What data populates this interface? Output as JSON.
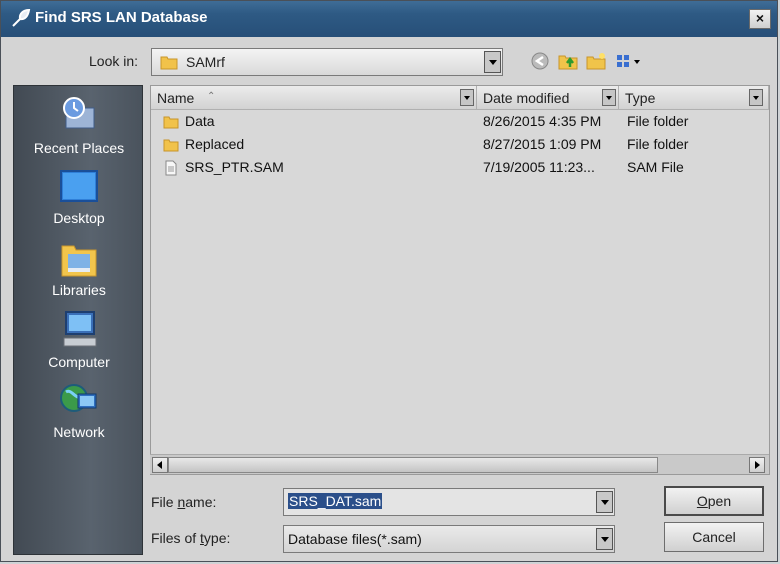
{
  "window": {
    "title": "Find SRS LAN Database",
    "close_glyph": "×"
  },
  "look_in": {
    "label": "Look in:",
    "value": "SAMrf"
  },
  "toolbar": {
    "icons": [
      "back-icon",
      "up-folder-icon",
      "new-folder-icon",
      "views-menu-icon"
    ]
  },
  "places": [
    {
      "label": "Recent Places",
      "icon": "recent-places-icon"
    },
    {
      "label": "Desktop",
      "icon": "desktop-icon"
    },
    {
      "label": "Libraries",
      "icon": "libraries-icon"
    },
    {
      "label": "Computer",
      "icon": "computer-icon"
    },
    {
      "label": "Network",
      "icon": "network-icon"
    }
  ],
  "columns": {
    "name": "Name",
    "date": "Date modified",
    "type": "Type"
  },
  "files": [
    {
      "name": "Data",
      "date": "8/26/2015 4:35 PM",
      "type": "File folder",
      "icon": "folder-icon"
    },
    {
      "name": "Replaced",
      "date": "8/27/2015 1:09 PM",
      "type": "File folder",
      "icon": "folder-icon"
    },
    {
      "name": "SRS_PTR.SAM",
      "date": "7/19/2005 11:23...",
      "type": "SAM File",
      "icon": "file-icon"
    }
  ],
  "file_name": {
    "label_prefix": "File ",
    "label_underlined": "n",
    "label_suffix": "ame:",
    "value": "SRS_DAT.sam"
  },
  "file_type": {
    "label_prefix": "Files of ",
    "label_underlined": "t",
    "label_suffix": "ype:",
    "value": "Database files(*.sam)"
  },
  "buttons": {
    "open_underlined": "O",
    "open_rest": "pen",
    "cancel": "Cancel"
  },
  "colors": {
    "titlebar": "#2e5a84",
    "selection": "#2b4f8a",
    "places_panel": "#4f5862"
  }
}
